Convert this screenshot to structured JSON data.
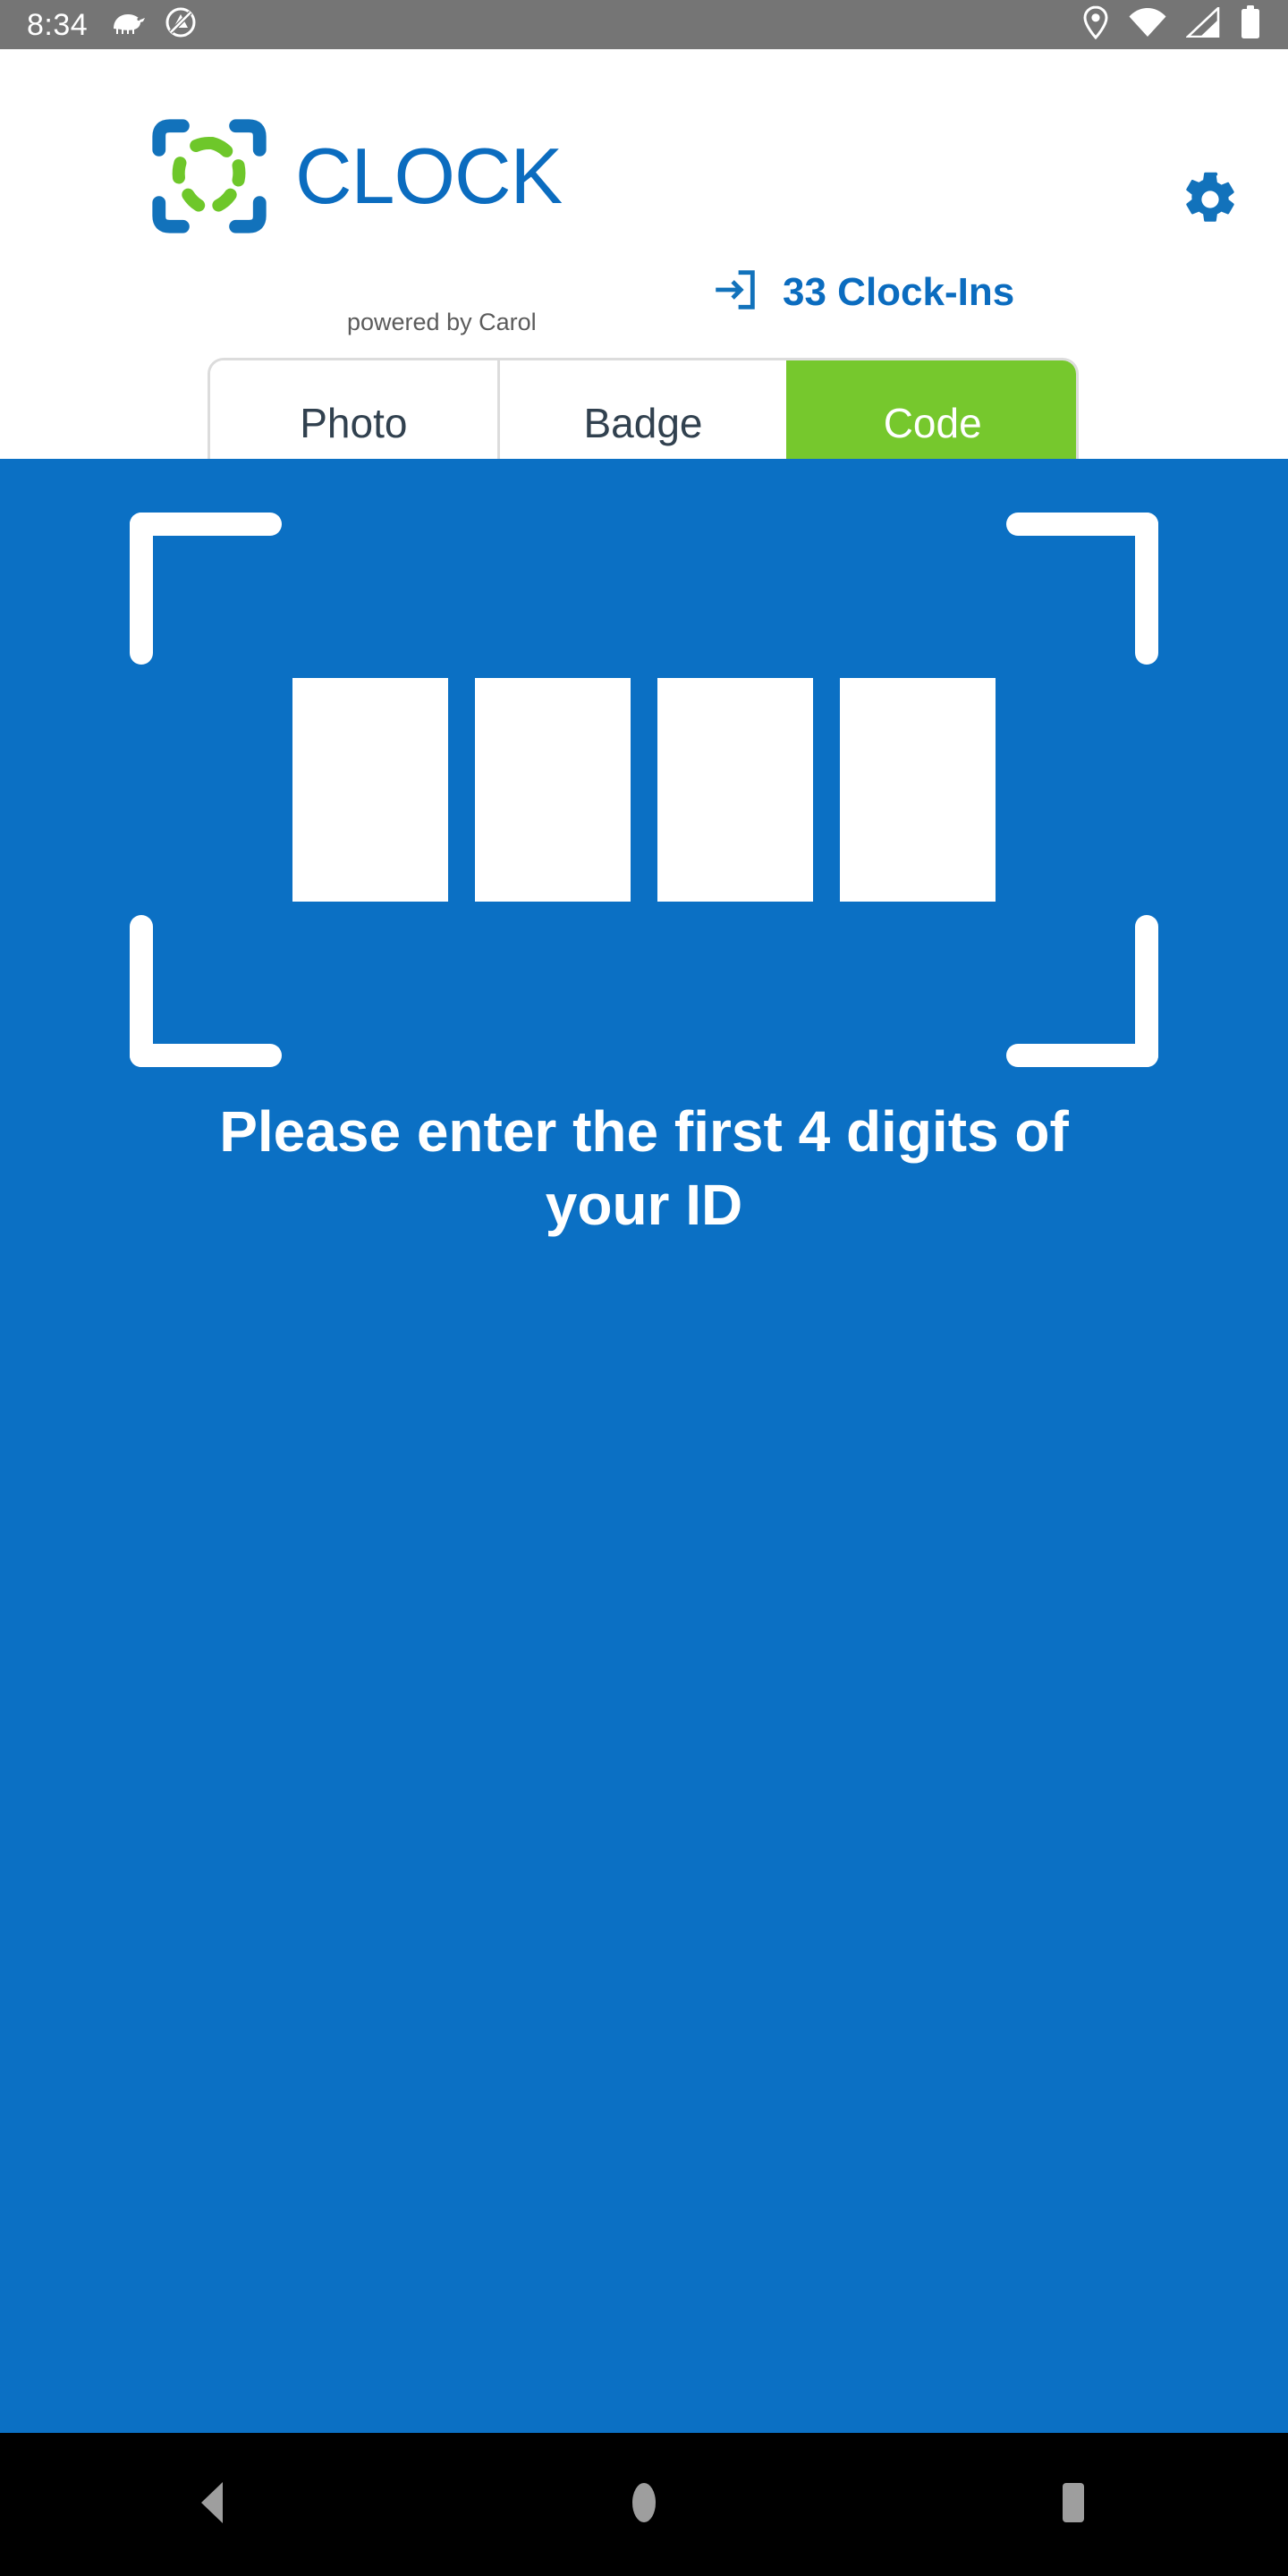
{
  "status_bar": {
    "time": "8:34",
    "left_icons": [
      "anteater-icon",
      "no-screenshot-icon"
    ],
    "right_icons": [
      "location-pin-icon",
      "wifi-icon",
      "cellular-signal-icon",
      "battery-icon"
    ],
    "background_color": "#757575"
  },
  "header": {
    "logo_icon": "scan-frame-logo-icon",
    "app_title": "CLOCK",
    "powered_by": "powered by Carol",
    "settings_icon": "gear-icon",
    "clock_ins": {
      "icon": "login-arrow-icon",
      "label": "33 Clock-Ins",
      "count": 33
    },
    "brand_blue": "#0b6cbf",
    "brand_green": "#76c82d"
  },
  "tabs": {
    "items": [
      {
        "label": "Photo",
        "active": false
      },
      {
        "label": "Badge",
        "active": false
      },
      {
        "label": "Code",
        "active": true
      }
    ],
    "active_background": "#76c82d",
    "border_color": "#dcdcdc"
  },
  "scanner": {
    "background_color": "#0b70c4",
    "frame_icon": "scan-corner-brackets",
    "digit_count": 4,
    "digits": [
      "",
      "",
      "",
      ""
    ],
    "prompt": "Please enter the first 4 digits of your ID"
  },
  "nav_bar": {
    "background_color": "#000000",
    "buttons": [
      {
        "name": "back-button",
        "icon": "triangle-left-icon"
      },
      {
        "name": "home-button",
        "icon": "circle-icon"
      },
      {
        "name": "recents-button",
        "icon": "square-icon"
      }
    ]
  }
}
